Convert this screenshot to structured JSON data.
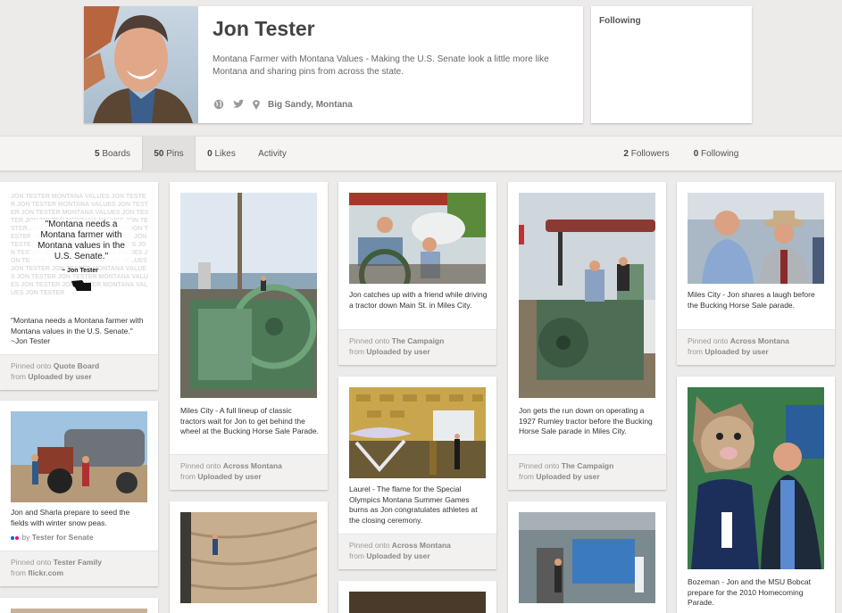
{
  "profile": {
    "name": "Jon Tester",
    "description": "Montana Farmer with Montana Values - Making the U.S. Senate look a little more like Montana and sharing pins from across the state.",
    "location": "Big Sandy, Montana"
  },
  "following_box": {
    "label": "Following"
  },
  "nav": {
    "boards_num": "5",
    "boards_label": "Boards",
    "pins_num": "50",
    "pins_label": "Pins",
    "likes_num": "0",
    "likes_label": "Likes",
    "activity_label": "Activity",
    "followers_num": "2",
    "followers_label": "Followers",
    "following_num": "0",
    "following_label": "Following"
  },
  "quote_image": {
    "quote_text": "\"Montana needs a Montana farmer with Montana values in the U.S. Senate.\"",
    "attribution": "~ Jon Tester",
    "pattern_text": "JON TESTER MONTANA VALUES JON TESTER"
  },
  "pins": [
    {
      "desc": "\"Montana needs a Montana farmer with Montana values in the U.S. Senate.\" ~Jon Tester",
      "pinned_prefix": "Pinned onto",
      "board": "Quote Board",
      "from_prefix": "from",
      "source": "Uploaded by user"
    },
    {
      "desc": "Jon and Sharla prepare to seed the fields with winter snow peas.",
      "via_prefix": "by",
      "via": "Tester for Senate",
      "pinned_prefix": "Pinned onto",
      "board": "Tester Family",
      "from_prefix": "from",
      "source": "flickr.com"
    },
    {
      "desc": "Miles City - A full lineup of classic tractors wait for Jon to get behind the wheel at the Bucking Horse Sale Parade.",
      "pinned_prefix": "Pinned onto",
      "board": "Across Montana",
      "from_prefix": "from",
      "source": "Uploaded by user"
    },
    {
      "desc": "Jon catches up with a friend while driving a tractor down Main St. in Miles City.",
      "pinned_prefix": "Pinned onto",
      "board": "The Campaign",
      "from_prefix": "from",
      "source": "Uploaded by user"
    },
    {
      "desc": "Laurel - The flame for the Special Olympics Montana Summer Games burns as Jon congratulates athletes at the closing ceremony.",
      "pinned_prefix": "Pinned onto",
      "board": "Across Montana",
      "from_prefix": "from",
      "source": "Uploaded by user"
    },
    {
      "desc": "Jon gets the run down on operating a 1927 Rumley tractor before the Bucking Horse Sale parade in Miles City.",
      "pinned_prefix": "Pinned onto",
      "board": "The Campaign",
      "from_prefix": "from",
      "source": "Uploaded by user"
    },
    {
      "desc": "Miles City - Jon shares a laugh before the Bucking Horse Sale parade.",
      "pinned_prefix": "Pinned onto",
      "board": "Across Montana",
      "from_prefix": "from",
      "source": "Uploaded by user"
    },
    {
      "desc": "Bozeman - Jon and the MSU Bobcat prepare for the 2010 Homecoming Parade."
    }
  ],
  "colors": {
    "background": "#ecebea",
    "card": "#ffffff",
    "footer": "#f2f1f0",
    "nav_active": "#e2e0de"
  },
  "icons": [
    "website-icon",
    "twitter-icon",
    "location-pin-icon",
    "flickr-icon"
  ]
}
